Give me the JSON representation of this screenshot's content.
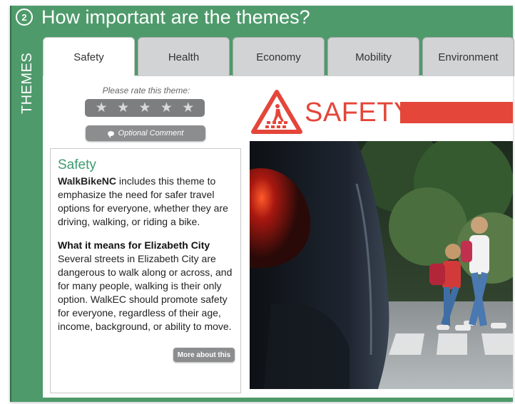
{
  "header": {
    "step_number": "2",
    "title": "How important are the themes?",
    "side_label": "THEMES"
  },
  "tabs": [
    {
      "label": "Safety",
      "active": true
    },
    {
      "label": "Health",
      "active": false
    },
    {
      "label": "Economy",
      "active": false
    },
    {
      "label": "Mobility",
      "active": false
    },
    {
      "label": "Environment",
      "active": false
    }
  ],
  "rating": {
    "prompt": "Please rate this theme:",
    "max_stars": 5,
    "selected": 0,
    "comment_label": "Optional Comment"
  },
  "info": {
    "title": "Safety",
    "brand": "WalkBikeNC",
    "intro_rest": " includes this theme to emphasize the need for safer travel options for everyone, whether they are driving, walking, or riding a bike.",
    "subheading": "What it means for Elizabeth City",
    "body": "Several streets in Elizabeth City are dangerous to walk along or across, and for many people, walking is their only option. WalkEC should promote safety for everyone, regardless of their age, income, background, or ability to move.",
    "more_label": "More about this"
  },
  "banner": {
    "word": "SAFETY",
    "accent_color": "#e4463a",
    "icon": "pedestrian-crossing-warning-icon"
  },
  "colors": {
    "frame_green": "#4e9a6b",
    "title_green": "#3c9a6f"
  }
}
